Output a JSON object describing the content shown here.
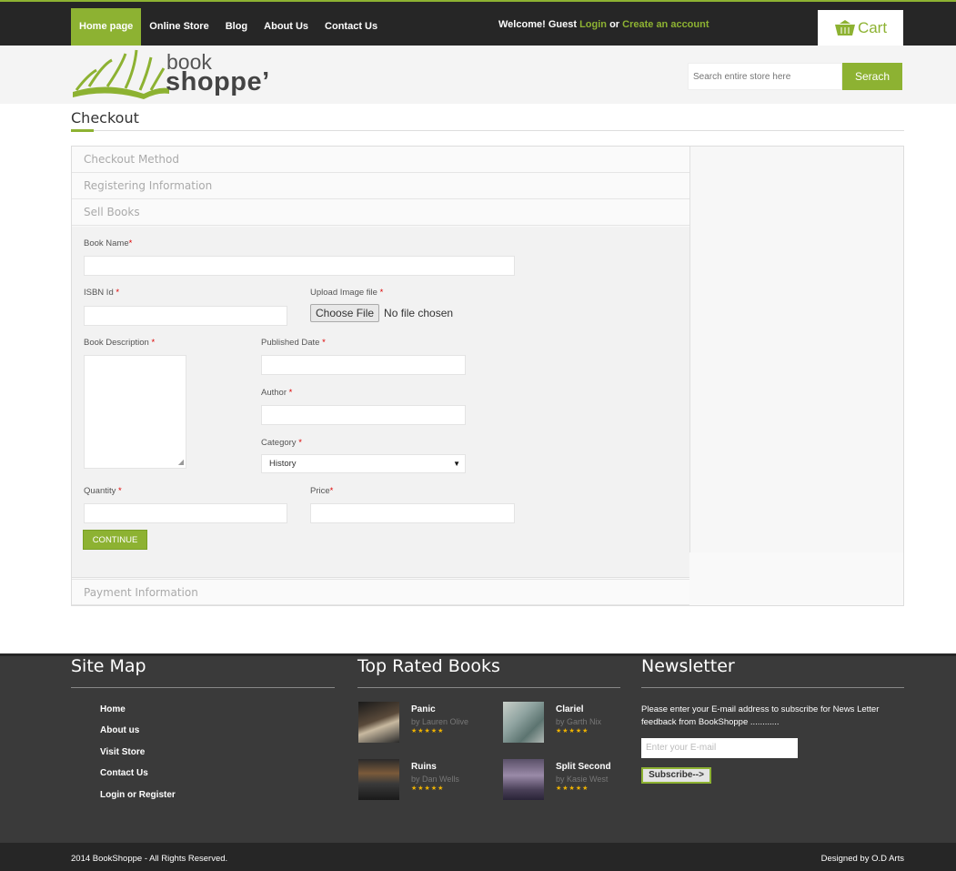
{
  "nav": {
    "items": [
      "Home page",
      "Online Store",
      "Blog",
      "About Us",
      "Contact Us"
    ],
    "active_index": 0
  },
  "welcome": {
    "prefix": "Welcome!",
    "user": "Guest",
    "login": "Login",
    "or": "or",
    "create": "Create an account"
  },
  "cart": {
    "label": "Cart",
    "icon": "cart-icon"
  },
  "logo": {
    "line1": "book",
    "line2": "shoppe’"
  },
  "search": {
    "placeholder": "Search entire store here",
    "button": "Serach"
  },
  "page": {
    "title": "Checkout"
  },
  "sections": [
    "Checkout Method",
    "Registering Information",
    "Sell Books",
    "Payment Information"
  ],
  "form": {
    "book_name": "Book Name",
    "isbn": "ISBN Id",
    "upload": "Upload Image file",
    "file_button": "Choose File",
    "file_status": "No file chosen",
    "description": "Book Description",
    "published": "Published Date",
    "author": "Author",
    "category": "Category",
    "category_value": "History",
    "quantity": "Quantity",
    "price": "Price",
    "required_mark": "*",
    "continue": "CONTINUE"
  },
  "footer": {
    "sitemap_title": "Site Map",
    "sitemap": [
      "Home",
      "About us",
      "Visit Store",
      "Contact Us",
      "Login or Register"
    ],
    "top_title": "Top Rated Books",
    "books": [
      {
        "title": "Panic",
        "author": "by Lauren Olive",
        "stars": "★★★★★"
      },
      {
        "title": "Clariel",
        "author": "by Garth Nix",
        "stars": "★★★★★"
      },
      {
        "title": "Ruins",
        "author": "by Dan Wells",
        "stars": "★★★★★"
      },
      {
        "title": "Split Second",
        "author": "by Kasie West",
        "stars": "★★★★★"
      }
    ],
    "newsletter_title": "Newsletter",
    "newsletter_text": "Please enter your E-mail address to subscribe for News Letter feedback from BookShoppe ............",
    "newsletter_placeholder": "Enter your E-mail",
    "subscribe": "Subscribe-->",
    "copyright": "2014 BookShoppe - All Rights Reserved.",
    "designed": "Designed by O.D Arts"
  },
  "colors": {
    "accent": "#8db232",
    "dark": "#262626",
    "footer": "#3a3a3a",
    "required": "#dd0000"
  }
}
